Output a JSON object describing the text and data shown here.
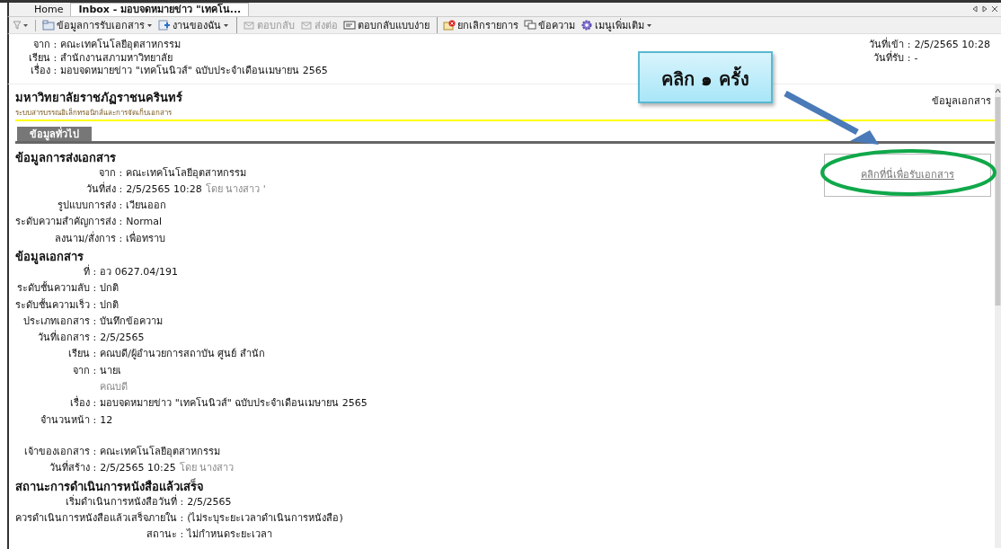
{
  "tabs": [
    {
      "label": "Home",
      "selected": false
    },
    {
      "label": "Inbox - มอบจดหมายข่าว \"เทคโน...",
      "selected": true
    }
  ],
  "toolbar": [
    {
      "label": "ข้อมูลการรับเอกสาร",
      "dropdown": true,
      "disabled": false,
      "sep_before": false
    },
    {
      "label": "งานของฉัน",
      "dropdown": true,
      "disabled": false,
      "sep_before": false
    },
    {
      "label": "ตอบกลับ",
      "dropdown": false,
      "disabled": true,
      "sep_before": true
    },
    {
      "label": "ส่งต่อ",
      "dropdown": false,
      "disabled": true,
      "sep_before": false
    },
    {
      "label": "ตอบกลับแบบง่าย",
      "dropdown": false,
      "disabled": false,
      "sep_before": false
    },
    {
      "label": "ยกเลิกรายการ",
      "dropdown": false,
      "disabled": false,
      "sep_before": true
    },
    {
      "label": "ข้อความ",
      "dropdown": false,
      "disabled": false,
      "sep_before": false
    },
    {
      "label": "เมนูเพิ่มเติม",
      "dropdown": true,
      "disabled": false,
      "sep_before": false
    }
  ],
  "header": {
    "left": [
      {
        "label": "จาก :",
        "value": "คณะเทคโนโลยีอุตสาหกรรม"
      },
      {
        "label": "เรียน :",
        "value": "สำนักงานสภามหาวิทยาลัย"
      },
      {
        "label": "เรื่อง :",
        "value": "มอบจดหมายข่าว \"เทคโนนิวส์\" ฉบับประจำเดือนเมษายน 2565"
      }
    ],
    "right": [
      {
        "label": "วันที่เข้า :",
        "value": "2/5/2565 10:28"
      },
      {
        "label": "วันที่รับ :",
        "value": "-"
      }
    ]
  },
  "document": {
    "title": "มหาวิทยาลัยราชภัฏราชนครินทร์",
    "subtitle": "ระบบสารบรรณอิเล็กทรอนิกส์และการจัดเก็บเอกสาร",
    "side_link": "ข้อมูลเอกสาร",
    "tab": "ข้อมูลทั่วไป",
    "receive_button": "คลิกที่นี่เพื่อรับเอกสาร",
    "sections": [
      {
        "heading": "ข้อมูลการส่งเอกสาร",
        "groups": [
          [
            {
              "label": "จาก :",
              "value": "คณะเทคโนโลยีอุตสาหกรรม"
            },
            {
              "label": "วันที่ส่ง :",
              "value": "2/5/2565 10:28",
              "note": "โดย นางสาว '"
            },
            {
              "label": "รูปแบบการส่ง :",
              "value": "เวียนออก"
            },
            {
              "label": "ระดับความสำคัญการส่ง :",
              "value": "Normal"
            },
            {
              "label": "ลงนาม/สั่งการ :",
              "value": "เพื่อทราบ"
            }
          ]
        ]
      },
      {
        "heading": "ข้อมูลเอกสาร",
        "groups": [
          [
            {
              "label": "ที่ :",
              "value": "อว 0627.04/191"
            },
            {
              "label": "ระดับชั้นความลับ :",
              "value": "ปกติ"
            },
            {
              "label": "ระดับชั้นความเร็ว :",
              "value": "ปกติ"
            },
            {
              "label": "ประเภทเอกสาร :",
              "value": "บันทึกข้อความ"
            },
            {
              "label": "วันที่เอกสาร :",
              "value": "2/5/2565"
            },
            {
              "label": "เรียน :",
              "value": "คณบดี/ผู้อำนวยการสถาบัน ศูนย์ สำนัก"
            },
            {
              "label": "จาก :",
              "value": "นายเ"
            },
            {
              "note": "คณบดี"
            },
            {
              "label": "เรื่อง :",
              "value": "มอบจดหมายข่าว \"เทคโนนิวส์\" ฉบับประจำเดือนเมษายน 2565"
            },
            {
              "label": "จำนวนหน้า :",
              "value": "12"
            }
          ],
          [
            {
              "label": "เจ้าของเอกสาร :",
              "value": "คณะเทคโนโลยีอุตสาหกรรม"
            },
            {
              "label": "วันที่สร้าง :",
              "value": "2/5/2565 10:25",
              "note": "โดย นางสาว"
            }
          ]
        ]
      },
      {
        "heading": "สถานะการดำเนินการหนังสือแล้วเสร็จ",
        "groups": [
          [
            {
              "label": "เริ่มดำเนินการหนังสือวันที่ :",
              "value": "2/5/2565"
            },
            {
              "label": "ควรดำเนินการหนังสือแล้วเสร็จภายใน :",
              "value": "(ไม่ระบุระยะเวลาดำเนินการหนังสือ)"
            },
            {
              "label": "สถานะ :",
              "value": "ไม่กำหนดระยะเวลา"
            }
          ]
        ]
      }
    ]
  },
  "callout": {
    "text": "คลิก ๑ ครั้ง"
  }
}
